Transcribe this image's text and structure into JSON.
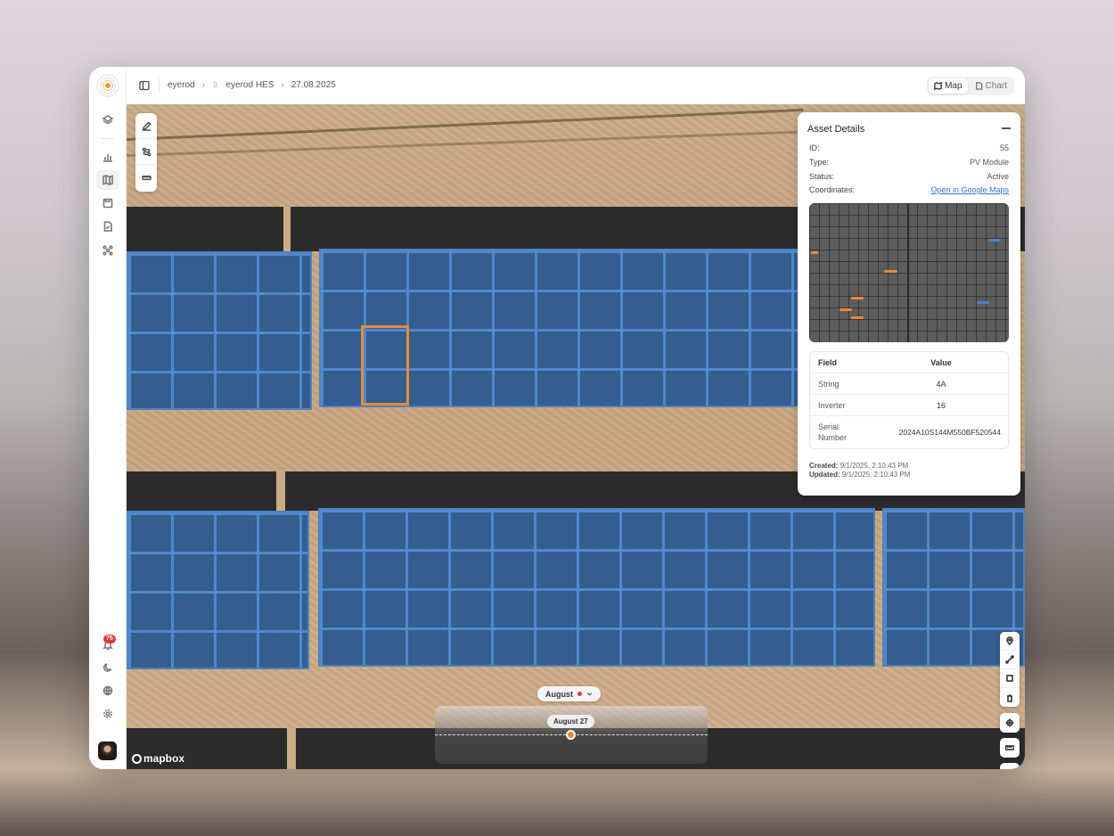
{
  "breadcrumb": {
    "items": [
      "eyerod",
      "eyerod HES",
      "27.08.2025"
    ]
  },
  "view_toggle": {
    "map_label": "Map",
    "chart_label": "Chart",
    "active": "Map"
  },
  "sidebar": {
    "items": [
      {
        "icon": "layers-icon",
        "active": false
      },
      {
        "icon": "bar-chart-icon",
        "active": false
      },
      {
        "icon": "map-icon",
        "active": true
      },
      {
        "icon": "save-icon",
        "active": false
      },
      {
        "icon": "report-icon",
        "active": false
      },
      {
        "icon": "drone-icon",
        "active": false
      }
    ],
    "notification_count": "75",
    "bottom_icons": [
      "moon-icon",
      "globe-icon",
      "gear-icon"
    ]
  },
  "asset_details": {
    "title": "Asset Details",
    "rows": [
      {
        "key": "ID:",
        "value": "55"
      },
      {
        "key": "Type:",
        "value": "PV Module"
      },
      {
        "key": "Status:",
        "value": "Active"
      },
      {
        "key": "Coordinates:",
        "value": "Open in Google Maps"
      }
    ],
    "table": {
      "headers": [
        "Field",
        "Value"
      ],
      "rows": [
        {
          "field": "String",
          "value": "4A"
        },
        {
          "field": "Inverter",
          "value": "16"
        },
        {
          "field": "Serial Number",
          "value": "2024A10S144M550BF520544"
        }
      ]
    },
    "created_label": "Created:",
    "created_value": "9/1/2025, 2:10:43 PM",
    "updated_label": "Updated:",
    "updated_value": "9/1/2025, 2:10:43 PM"
  },
  "timeline": {
    "month": "August",
    "date_tip": "August 27"
  },
  "map": {
    "attribution": "mapbox"
  },
  "colors": {
    "accent_blue": "#3b6fd8",
    "selection_orange": "#e68a3a",
    "pv_blue": "#335e8e",
    "badge_red": "#e23b3b"
  }
}
